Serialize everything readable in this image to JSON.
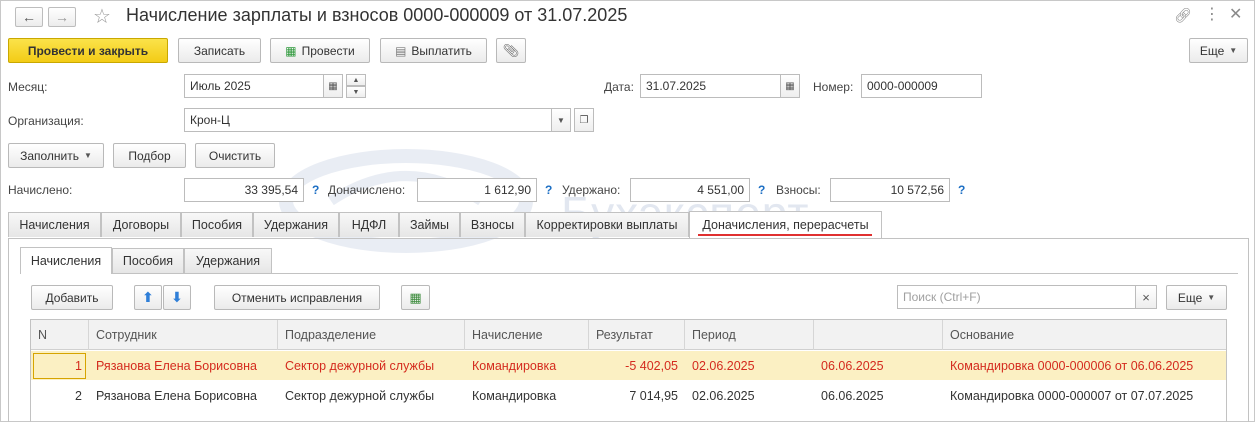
{
  "window": {
    "title": "Начисление зарплаты и взносов 0000-000009 от 31.07.2025"
  },
  "toolbar": {
    "post_close": "Провести и закрыть",
    "save": "Записать",
    "post": "Провести",
    "pay": "Выплатить",
    "more": "Еще"
  },
  "form": {
    "month_label": "Месяц:",
    "month_value": "Июль 2025",
    "date_label": "Дата:",
    "date_value": "31.07.2025",
    "number_label": "Номер:",
    "number_value": "0000-000009",
    "org_label": "Организация:",
    "org_value": "Крон-Ц",
    "fill": "Заполнить",
    "select": "Подбор",
    "clear": "Очистить"
  },
  "totals": {
    "accrued_label": "Начислено:",
    "accrued_value": "33 395,54",
    "extra_label": "Доначислено:",
    "extra_value": "1 612,90",
    "withheld_label": "Удержано:",
    "withheld_value": "4 551,00",
    "contrib_label": "Взносы:",
    "contrib_value": "10 572,56",
    "help": "?"
  },
  "tabs": [
    "Начисления",
    "Договоры",
    "Пособия",
    "Удержания",
    "НДФЛ",
    "Займы",
    "Взносы",
    "Корректировки выплаты",
    "Доначисления, перерасчеты"
  ],
  "subtabs": [
    "Начисления",
    "Пособия",
    "Удержания"
  ],
  "subtoolbar": {
    "add": "Добавить",
    "cancel_fix": "Отменить исправления",
    "search_placeholder": "Поиск (Ctrl+F)",
    "search_clear": "×",
    "more": "Еще"
  },
  "table": {
    "columns": [
      "N",
      "Сотрудник",
      "Подразделение",
      "Начисление",
      "Результат",
      "Период",
      "",
      "Основание"
    ],
    "rows": [
      [
        "1",
        "Рязанова Елена Борисовна",
        "Сектор дежурной службы",
        "Командировка",
        "-5 402,05",
        "02.06.2025",
        "06.06.2025",
        "Командировка 0000-000006 от 06.06.2025"
      ],
      [
        "2",
        "Рязанова Елена Борисовна",
        "Сектор дежурной службы",
        "Командировка",
        "7 014,95",
        "02.06.2025",
        "06.06.2025",
        "Командировка 0000-000007 от 07.07.2025"
      ]
    ]
  },
  "watermark": "Бухэксперт",
  "colors": {
    "accent_yellow": "#f3cc16",
    "selected_row": "#fbf0c3",
    "red_text": "#d42b1e",
    "underline_red": "#e03030",
    "help_blue": "#1d6fc4"
  }
}
